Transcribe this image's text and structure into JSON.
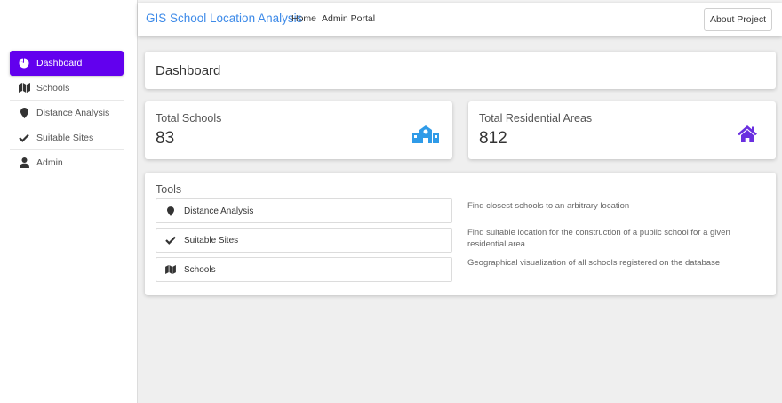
{
  "colors": {
    "accent": "#6200ee",
    "brand": "#3d8ae8",
    "school_icon": "#2f9be8",
    "home_icon": "#6a2fe0"
  },
  "navbar": {
    "brand": "GIS School Location Analysis",
    "links": [
      "Home",
      "Admin Portal"
    ],
    "about_button": "About Project"
  },
  "sidebar": {
    "items": [
      {
        "label": "Dashboard",
        "icon": "pie-chart-icon",
        "active": true
      },
      {
        "label": "Schools",
        "icon": "map-icon",
        "active": false
      },
      {
        "label": "Distance Analysis",
        "icon": "map-marker-icon",
        "active": false
      },
      {
        "label": "Suitable Sites",
        "icon": "check-icon",
        "active": false
      },
      {
        "label": "Admin",
        "icon": "user-icon",
        "active": false
      }
    ]
  },
  "main": {
    "title": "Dashboard",
    "stats": [
      {
        "label": "Total Schools",
        "value": "83",
        "icon": "school-icon"
      },
      {
        "label": "Total Residential Areas",
        "value": "812",
        "icon": "home-icon"
      }
    ],
    "tools": {
      "title": "Tools",
      "items": [
        {
          "label": "Distance Analysis",
          "icon": "map-marker-icon",
          "description": "Find closest schools to an arbitrary location"
        },
        {
          "label": "Suitable Sites",
          "icon": "check-icon",
          "description": "Find suitable location for the construction of a public school for a given residential area"
        },
        {
          "label": "Schools",
          "icon": "map-icon",
          "description": "Geographical visualization of all schools registered on the database"
        }
      ]
    }
  }
}
